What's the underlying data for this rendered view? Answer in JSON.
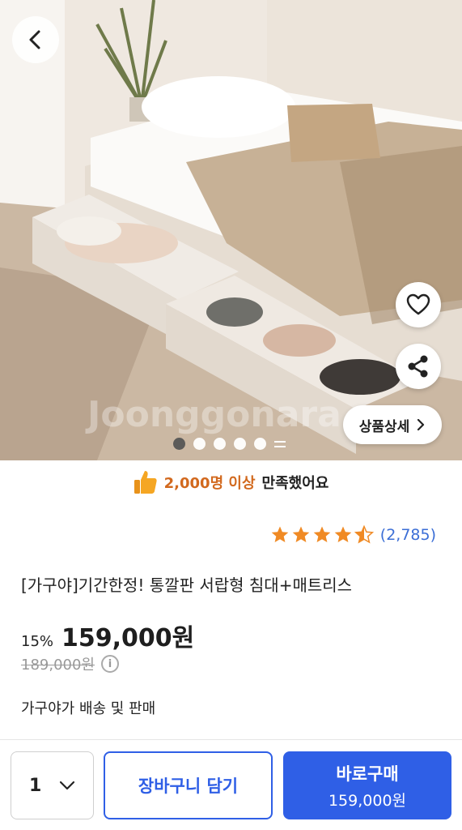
{
  "hero": {
    "watermark": "Joonggonara",
    "detail_button_label": "상품상세",
    "image_count": 5,
    "active_image_index": 0
  },
  "satisfaction": {
    "highlight": "2,000명 이상",
    "rest": "만족했어요"
  },
  "rating": {
    "stars": 4.5,
    "review_count": "(2,785)",
    "star_color": "#f08a24"
  },
  "product": {
    "title": "[가구야]기간한정! 통깔판 서랍형 침대+매트리스",
    "discount": "15%",
    "price": "159,000원",
    "original_price": "189,000원",
    "seller_info": "가구야가 배송 및 판매"
  },
  "bottom_bar": {
    "quantity": "1",
    "cart_label": "장바구니 담기",
    "buy_label": "바로구매",
    "buy_price": "159,000원",
    "accent_color": "#2f5fe6"
  },
  "icons": {
    "back": "chevron-left-icon",
    "wishlist": "heart-icon",
    "share": "share-icon",
    "detail_arrow": "chevron-right-icon",
    "thumbs_up": "thumbs-up-icon",
    "info": "info-icon",
    "quantity_dropdown": "chevron-down-icon"
  }
}
